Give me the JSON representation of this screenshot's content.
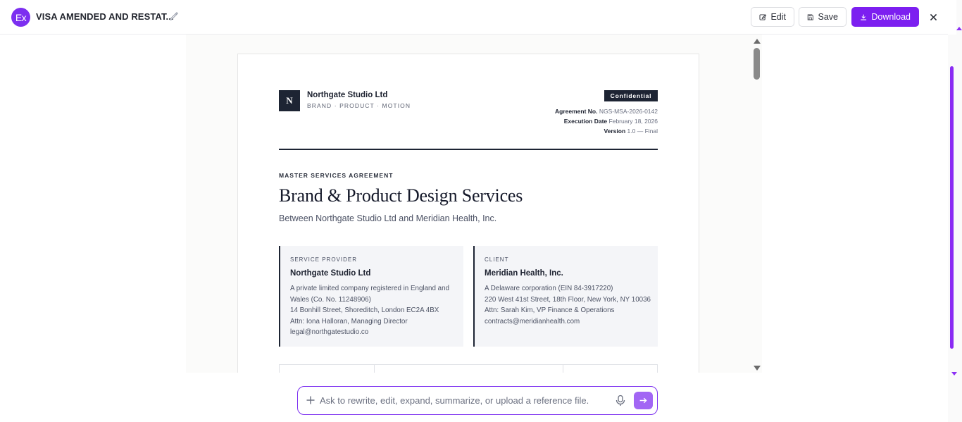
{
  "header": {
    "logo_text": "Ex",
    "title": "VISA AMENDED AND RESTAT...",
    "edit_label": "Edit",
    "save_label": "Save",
    "download_label": "Download"
  },
  "document": {
    "company": "Northgate Studio Ltd",
    "tagline": "BRAND · PRODUCT · MOTION",
    "monogram": "N",
    "badge": "Confidential",
    "meta": [
      {
        "label": "Agreement No.",
        "value": "NGS-MSA-2026-0142"
      },
      {
        "label": "Execution Date",
        "value": "February 18, 2026"
      },
      {
        "label": "Version",
        "value": "1.0 — Final"
      }
    ],
    "kicker": "MASTER SERVICES AGREEMENT",
    "title": "Brand & Product Design Services",
    "subtitle": "Between Northgate Studio Ltd and Meridian Health, Inc.",
    "parties": [
      {
        "label": "SERVICE PROVIDER",
        "name": "Northgate Studio Ltd",
        "lines": [
          "A private limited company registered in England and Wales (Co. No. 11248906)",
          "14 Bonhill Street, Shoreditch, London EC2A 4BX",
          "Attn: Iona Halloran, Managing Director",
          "legal@northgatestudio.co"
        ]
      },
      {
        "label": "CLIENT",
        "name": "Meridian Health, Inc.",
        "lines": [
          "A Delaware corporation (EIN 84-3917220)",
          "220 West 41st Street, 18th Floor, New York, NY 10036",
          "Attn: Sarah Kim, VP Finance & Operations",
          "contracts@meridianhealth.com"
        ]
      }
    ]
  },
  "prompt": {
    "placeholder": "Ask to rewrite, edit, expand, summarize, or upload a reference file."
  },
  "colors": {
    "accent": "#7c1ff0",
    "navy": "#1d2433"
  },
  "icons": [
    "pencil-icon",
    "edit-icon",
    "save-icon",
    "download-icon",
    "close-icon",
    "plus-icon",
    "mic-icon",
    "send-arrow-icon"
  ]
}
